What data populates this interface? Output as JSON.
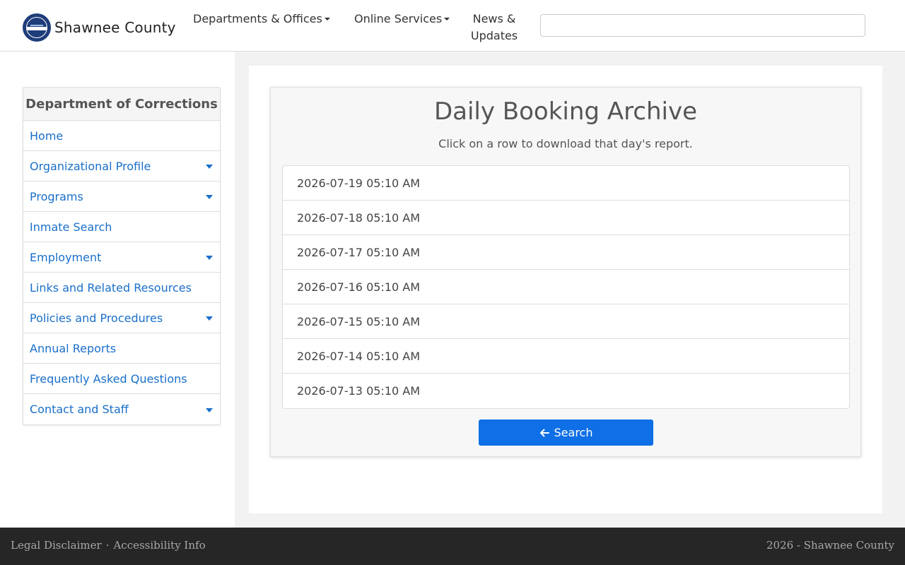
{
  "header": {
    "brand_name": "Shawnee County",
    "nav": [
      {
        "label": "Departments & Offices"
      },
      {
        "label": "Online Services"
      },
      {
        "label_line1": "News &",
        "label_line2": "Updates"
      }
    ],
    "search_placeholder": ""
  },
  "sidebar": {
    "title": "Department of Corrections",
    "items": [
      {
        "label": "Home",
        "has_submenu": false
      },
      {
        "label": "Organizational Profile",
        "has_submenu": true
      },
      {
        "label": "Programs",
        "has_submenu": true
      },
      {
        "label": "Inmate Search",
        "has_submenu": false
      },
      {
        "label": "Employment",
        "has_submenu": true
      },
      {
        "label": "Links and Related Resources",
        "has_submenu": false
      },
      {
        "label": "Policies and Procedures",
        "has_submenu": true
      },
      {
        "label": "Annual Reports",
        "has_submenu": false
      },
      {
        "label": "Frequently Asked Questions",
        "has_submenu": false
      },
      {
        "label": "Contact and Staff",
        "has_submenu": true
      }
    ]
  },
  "main": {
    "title": "Daily Booking Archive",
    "subtitle": "Click on a row to download that day's report.",
    "reports": [
      "2026-07-19 05:10 AM",
      "2026-07-18 05:10 AM",
      "2026-07-17 05:10 AM",
      "2026-07-16 05:10 AM",
      "2026-07-15 05:10 AM",
      "2026-07-14 05:10 AM",
      "2026-07-13 05:10 AM"
    ],
    "search_button_label": "Search"
  },
  "footer": {
    "legal": "Legal Disclaimer",
    "separator": "·",
    "accessibility": "Accessibility Info",
    "copyright": "2026 - Shawnee County"
  },
  "colors": {
    "link": "#1a6fc9",
    "button": "#0f6fe6",
    "footer_bg": "#262626"
  }
}
